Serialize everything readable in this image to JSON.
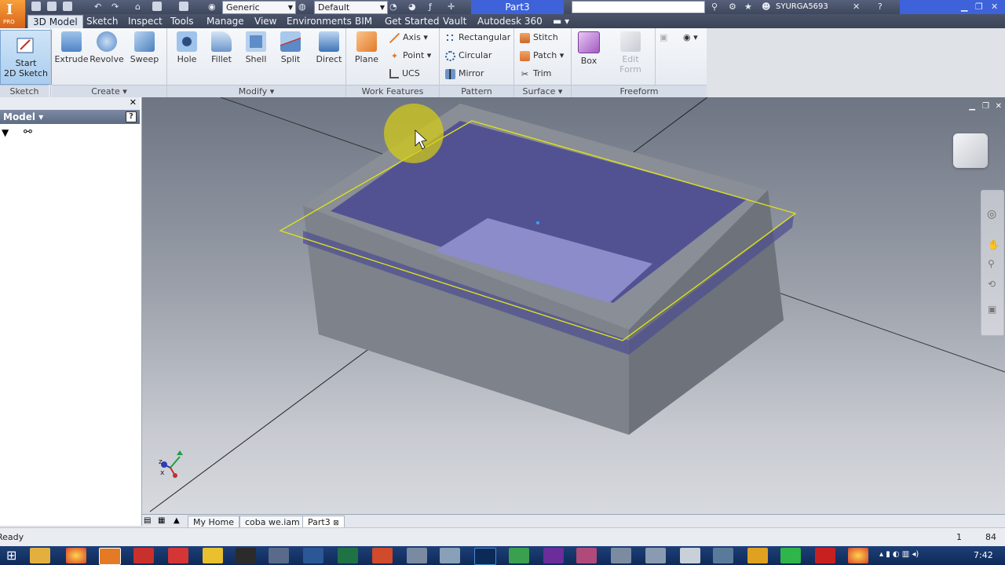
{
  "app": {
    "logo_text": "I",
    "logo_sub": "PRO",
    "style_combo": "Generic",
    "appearance_combo": "Default",
    "document_title": "Part3",
    "user_name": "SYURGA5693"
  },
  "menu_tabs": [
    "3D Model",
    "Sketch",
    "Inspect",
    "Tools",
    "Manage",
    "View",
    "Environments",
    "BIM",
    "Get Started",
    "Vault",
    "Autodesk 360"
  ],
  "ribbon": {
    "sketch_panel": {
      "label": "Sketch",
      "start_sketch_line1": "Start",
      "start_sketch_line2": "2D Sketch"
    },
    "create_panel": {
      "label": "Create",
      "extrude": "Extrude",
      "revolve": "Revolve",
      "sweep": "Sweep"
    },
    "modify_panel": {
      "label": "Modify",
      "hole": "Hole",
      "fillet": "Fillet",
      "shell": "Shell",
      "split": "Split",
      "direct": "Direct"
    },
    "work_features_panel": {
      "label": "Work Features",
      "plane": "Plane",
      "axis": "Axis",
      "point": "Point",
      "ucs": "UCS"
    },
    "pattern_panel": {
      "label": "Pattern",
      "rectangular": "Rectangular",
      "circular": "Circular",
      "mirror": "Mirror"
    },
    "surface_panel": {
      "label": "Surface",
      "stitch": "Stitch",
      "patch": "Patch",
      "trim": "Trim"
    },
    "freeform_panel": {
      "label": "Freeform",
      "box": "Box",
      "edit_form_line1": "Edit",
      "edit_form_line2": "Form"
    }
  },
  "browser": {
    "title": "Model"
  },
  "doc_tabs": [
    "My Home",
    "coba we.iam",
    "Part3"
  ],
  "status": {
    "text": "Ready",
    "count1": "1",
    "count2": "84"
  },
  "taskbar": {
    "clock": "7:42"
  },
  "colors": {
    "accent": "#3d62d9",
    "shell_fill": "#4f4f8f",
    "body_gray": "#7b7f88",
    "sketch_plane": "#d9e020"
  }
}
